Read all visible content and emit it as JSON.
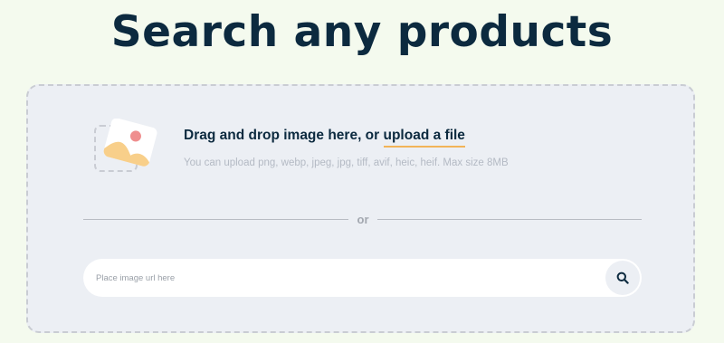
{
  "header": {
    "title": "Search any products"
  },
  "dropzone": {
    "title_prefix": "Drag and drop image here, or ",
    "upload_link": "upload a file",
    "hint": "You can upload png, webp, jpeg, jpg, tiff, avif, heic, heif. Max size 8MB",
    "illustration_icon": "image-upload-icon"
  },
  "divider": {
    "label": "or"
  },
  "url_search": {
    "placeholder": "Place image url here",
    "value": "",
    "button_icon": "search-icon"
  },
  "colors": {
    "background": "#f4faee",
    "title": "#0c2a3f",
    "dropzone_bg": "#eceff4",
    "accent_underline": "#f2b458"
  }
}
